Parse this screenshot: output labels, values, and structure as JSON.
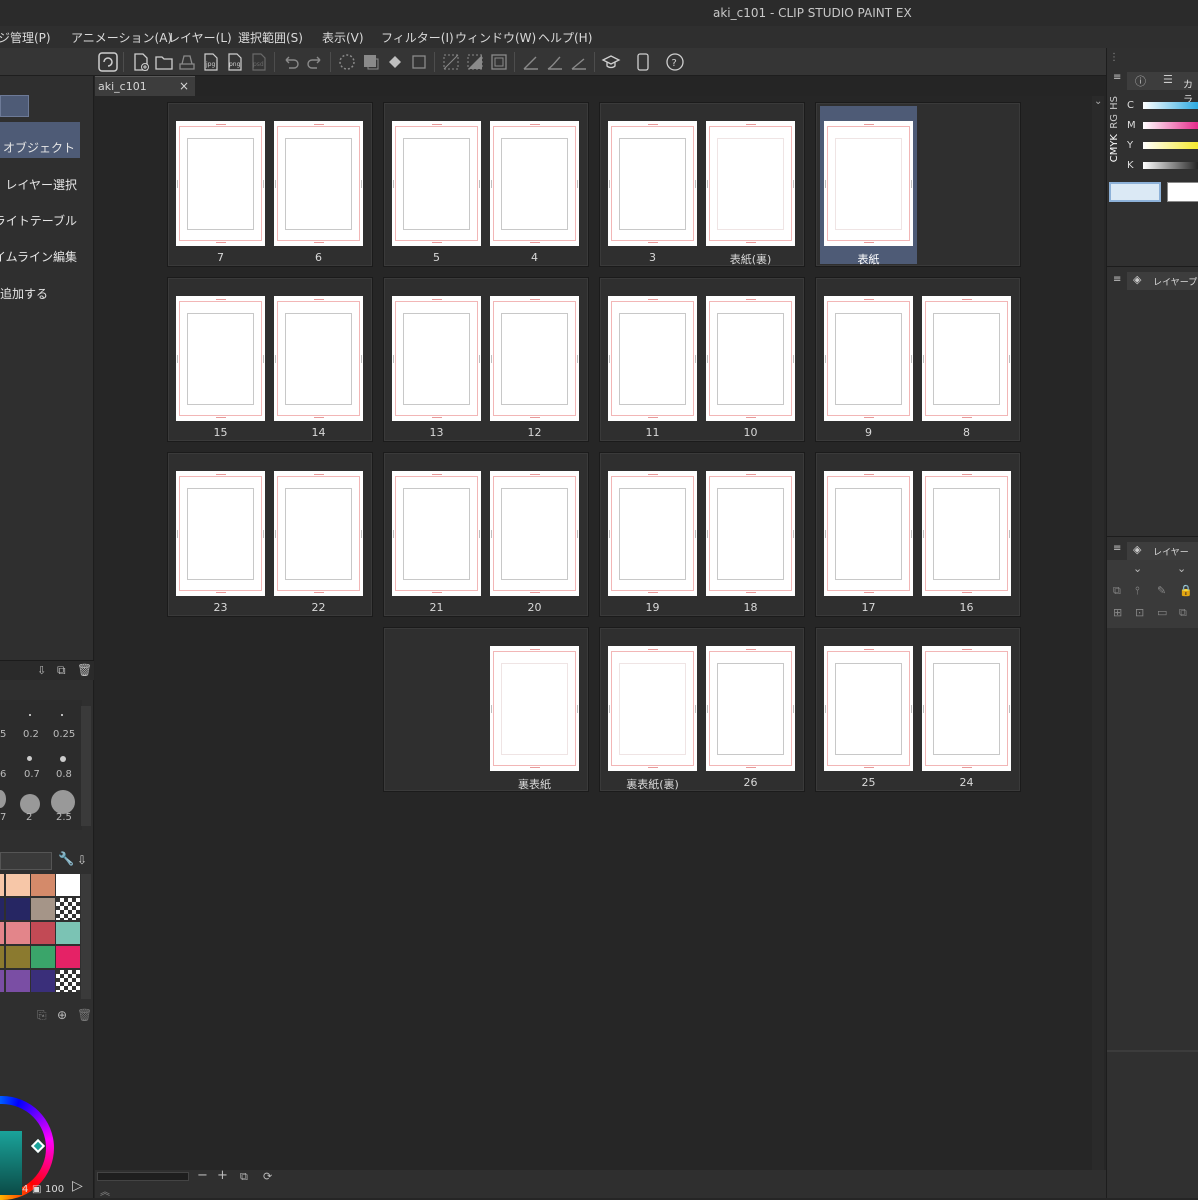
{
  "window": {
    "title": "aki_c101 - CLIP STUDIO PAINT EX"
  },
  "menu": [
    "ジ管理(P)",
    "アニメーション(A)",
    "レイヤー(L)",
    "選択範囲(S)",
    "表示(V)",
    "フィルター(I)",
    "ウィンドウ(W)",
    "ヘルプ(H)"
  ],
  "document_tab": {
    "label": "aki_c101",
    "close": "×"
  },
  "left_panel": {
    "subtools": [
      "オブジェクト",
      "レイヤー選択",
      "ライトテーブル",
      "タイムライン編集",
      "追加する"
    ],
    "brush_sizes_row1": [
      "5",
      "0.2",
      "0.25"
    ],
    "brush_sizes_row2": [
      "6",
      "0.7",
      "0.8"
    ],
    "brush_sizes_row3": [
      "7",
      "2",
      "2.5"
    ],
    "color_wheel_values": [
      "4",
      "100"
    ]
  },
  "right_panel": {
    "tab_color": "カラ",
    "color_labels": [
      "HS",
      "RG",
      "CMYK",
      "C",
      "M",
      "Y",
      "K"
    ],
    "tab_layer_property": "レイヤープロ",
    "tab_layer": "レイヤー"
  },
  "pages": {
    "row1": [
      [
        "7",
        "6"
      ],
      [
        "5",
        "4"
      ],
      [
        "3",
        "表紙(裏)"
      ],
      [
        "表紙"
      ]
    ],
    "row2": [
      [
        "15",
        "14"
      ],
      [
        "13",
        "12"
      ],
      [
        "11",
        "10"
      ],
      [
        "9",
        "8"
      ]
    ],
    "row3": [
      [
        "23",
        "22"
      ],
      [
        "21",
        "20"
      ],
      [
        "19",
        "18"
      ],
      [
        "17",
        "16"
      ]
    ],
    "row4": [
      [
        "裏表紙"
      ],
      [
        "裏表紙(裏)",
        "26"
      ],
      [
        "25",
        "24"
      ]
    ]
  },
  "colors": {
    "selection": "#4e5b76",
    "palette": [
      "#f7c7a8",
      "#d48a6a",
      "#ffffff",
      "#262663",
      "#a59588",
      "#e3858a",
      "#c24a55",
      "#7bc3b4",
      "#8b7a2f",
      "#3aa56a",
      "#e52266",
      "#7a4ea4",
      "#3a2f7a"
    ]
  }
}
